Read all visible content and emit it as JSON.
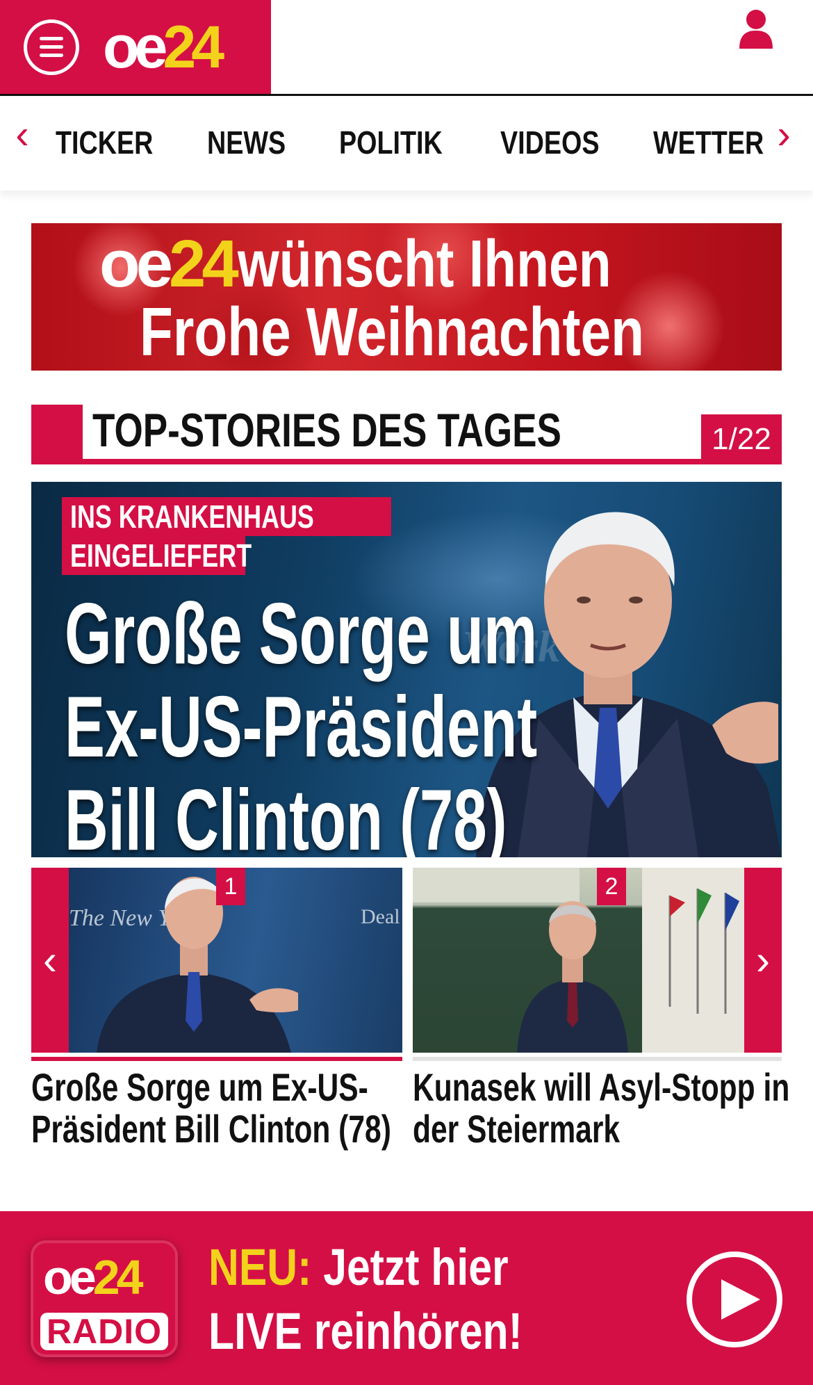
{
  "header": {
    "logo_oe": "oe",
    "logo_num": "24",
    "brand_color": "#d40f45",
    "accent_color": "#f3d21c",
    "menu_icon": "hamburger-menu-icon",
    "user_icon": "user-icon"
  },
  "nav": {
    "items": [
      "TICKER",
      "NEWS",
      "POLITIK",
      "VIDEOS",
      "WETTER"
    ]
  },
  "banner": {
    "logo_oe": "oe",
    "logo_num": "24",
    "line1": "wünscht Ihnen",
    "line2": "Frohe Weihnachten"
  },
  "top_stories": {
    "title": "TOP-STORIES DES TAGES",
    "counter": "1/22"
  },
  "hero": {
    "badge_line1": "INS KRANKENHAUS",
    "badge_line2": "EINGELIEFERT",
    "title_line1": "Große Sorge um",
    "title_line2": "Ex-US-Präsident",
    "title_line3": "Bill Clinton (78)",
    "watermark": "Work"
  },
  "cards": [
    {
      "number": "1",
      "title_line1": "Große Sorge um Ex-US-",
      "title_line2": "Präsident Bill Clinton (78)",
      "img_caption": "The New York",
      "img_caption2": "Deal"
    },
    {
      "number": "2",
      "title_line1": "Kunasek will Asyl-Stopp in",
      "title_line2": "der Steiermark"
    }
  ],
  "radio": {
    "logo_oe": "oe",
    "logo_num": "24",
    "logo_label": "RADIO",
    "neu": "NEU:",
    "line1_rest": "Jetzt hier",
    "line2": "LIVE reinhören!",
    "play_icon": "play-icon"
  }
}
